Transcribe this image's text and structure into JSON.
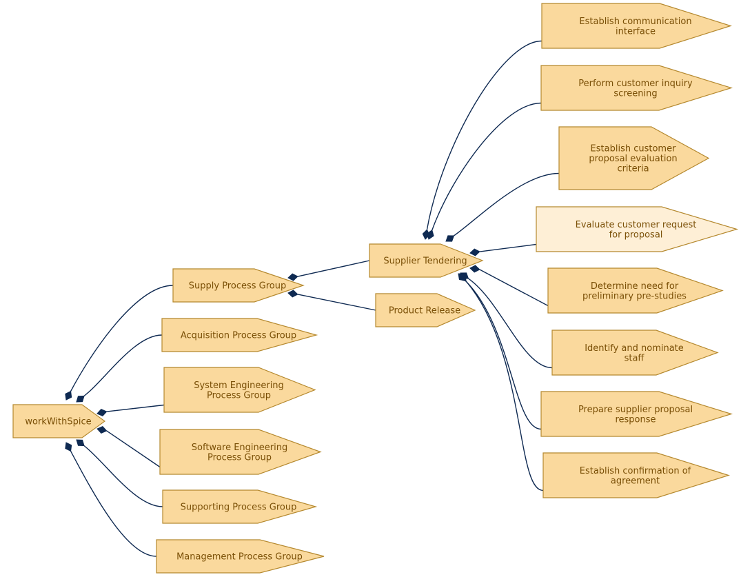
{
  "diagram": {
    "colors": {
      "node_fill": "#fad99d",
      "node_fill_highlight": "#feefd6",
      "node_border": "#b5892f",
      "node_text": "#7a4f06",
      "edge": "#0f2a52"
    },
    "relationship": "composition",
    "nodes": [
      {
        "id": "root",
        "label": [
          "workWithSpice"
        ]
      },
      {
        "id": "supply",
        "label": [
          "Supply Process Group"
        ]
      },
      {
        "id": "acq",
        "label": [
          "Acquisition Process Group"
        ]
      },
      {
        "id": "syseng",
        "label": [
          "System Engineering",
          "Process Group"
        ]
      },
      {
        "id": "sweng",
        "label": [
          "Software Engineering",
          "Process Group"
        ]
      },
      {
        "id": "supporting",
        "label": [
          "Supporting Process Group"
        ]
      },
      {
        "id": "mgmt",
        "label": [
          "Management Process Group"
        ]
      },
      {
        "id": "tender",
        "label": [
          "Supplier Tendering"
        ]
      },
      {
        "id": "release",
        "label": [
          "Product Release"
        ]
      },
      {
        "id": "t1",
        "label": [
          "Establish communication",
          "interface"
        ]
      },
      {
        "id": "t2",
        "label": [
          "Perform customer inquiry",
          "screening"
        ]
      },
      {
        "id": "t3",
        "label": [
          "Establish customer",
          "proposal evaluation",
          "criteria"
        ]
      },
      {
        "id": "t4",
        "label": [
          "Evaluate customer request",
          "for proposal"
        ],
        "highlighted": true
      },
      {
        "id": "t5",
        "label": [
          "Determine need for",
          "preliminary pre-studies"
        ]
      },
      {
        "id": "t6",
        "label": [
          "Identify and nominate",
          "staff"
        ]
      },
      {
        "id": "t7",
        "label": [
          "Prepare supplier proposal",
          "response"
        ]
      },
      {
        "id": "t8",
        "label": [
          "Establish confirmation of",
          "agreement"
        ]
      }
    ],
    "edges": [
      {
        "from": "root",
        "to": "supply"
      },
      {
        "from": "root",
        "to": "acq"
      },
      {
        "from": "root",
        "to": "syseng"
      },
      {
        "from": "root",
        "to": "sweng"
      },
      {
        "from": "root",
        "to": "supporting"
      },
      {
        "from": "root",
        "to": "mgmt"
      },
      {
        "from": "supply",
        "to": "tender"
      },
      {
        "from": "supply",
        "to": "release"
      },
      {
        "from": "tender",
        "to": "t1"
      },
      {
        "from": "tender",
        "to": "t2"
      },
      {
        "from": "tender",
        "to": "t3"
      },
      {
        "from": "tender",
        "to": "t4"
      },
      {
        "from": "tender",
        "to": "t5"
      },
      {
        "from": "tender",
        "to": "t6"
      },
      {
        "from": "tender",
        "to": "t7"
      },
      {
        "from": "tender",
        "to": "t8"
      }
    ]
  }
}
